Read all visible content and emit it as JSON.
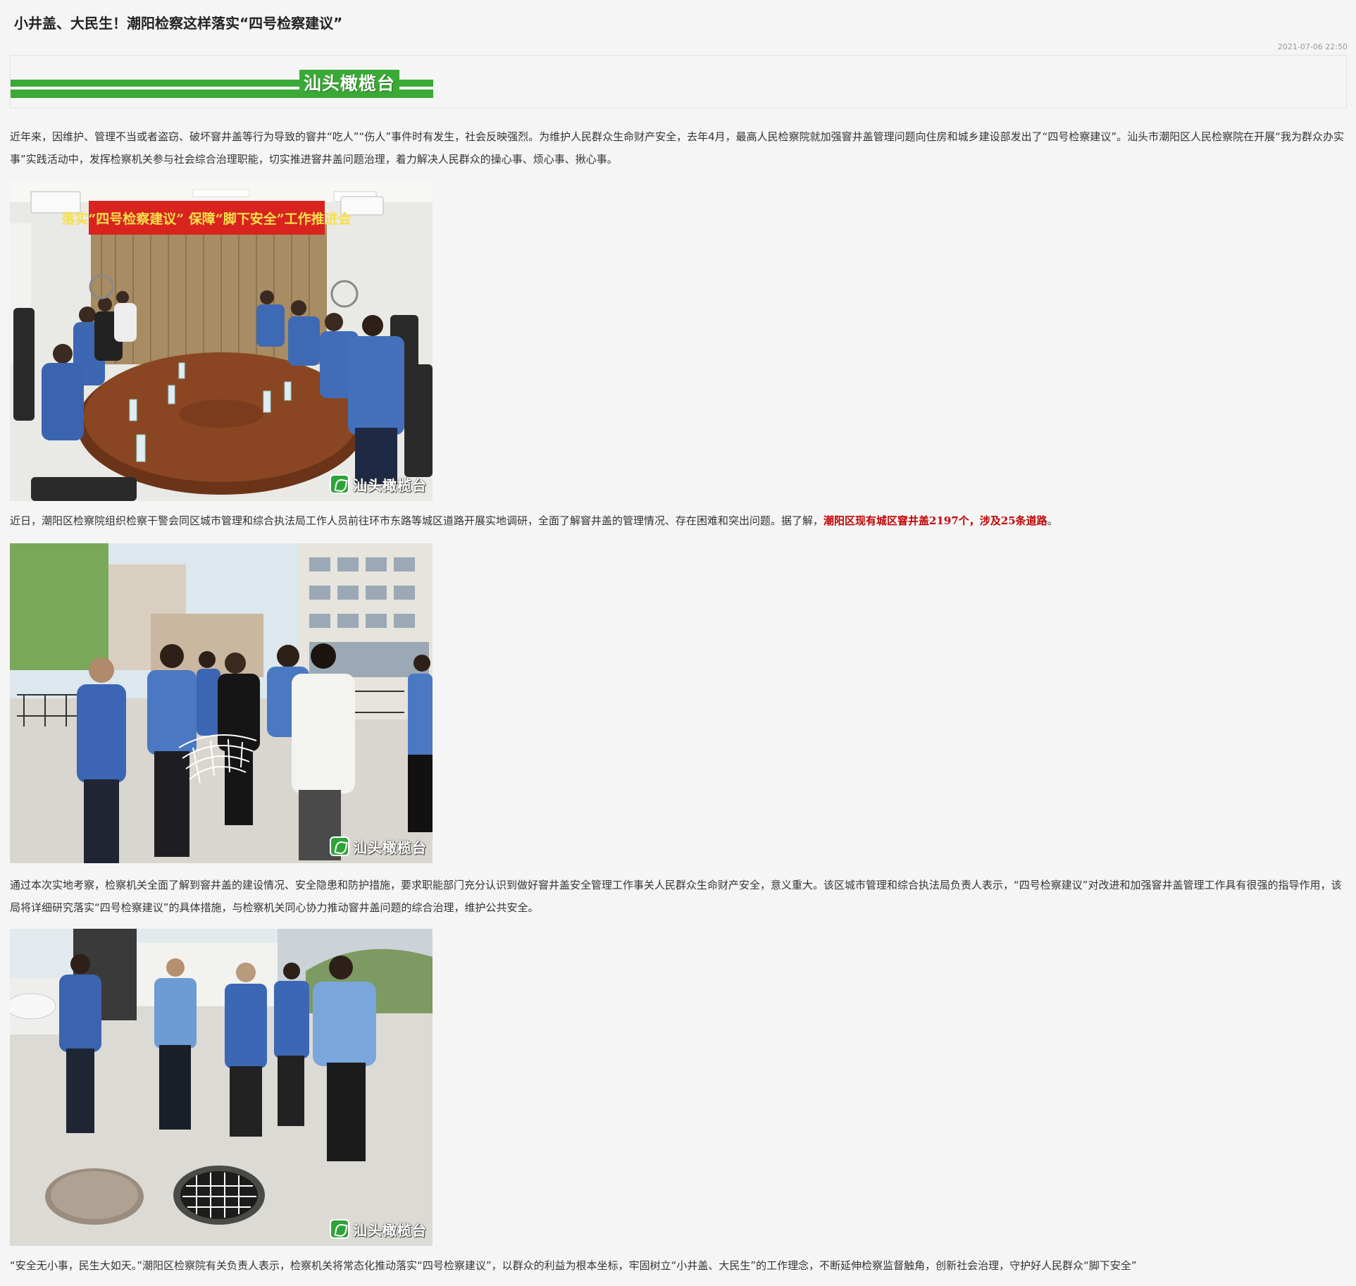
{
  "article": {
    "title": "小井盖、大民生！潮阳检察这样落实“四号检察建议”",
    "timestamp": "2021-07-06 22:50",
    "banner_text": "汕头橄榄台"
  },
  "paragraphs": {
    "p1": "近年来，因维护、管理不当或者盗窃、破坏窨井盖等行为导致的窨井“吃人”“伤人”事件时有发生，社会反映强烈。为维护人民群众生命财产安全，去年4月，最高人民检察院就加强窨井盖管理问题向住房和城乡建设部发出了“四号检察建议”。汕头市潮阳区人民检察院在开展“我为群众办实事”实践活动中，发挥检察机关参与社会综合治理职能，切实推进窨井盖问题治理，着力解决人民群众的操心事、烦心事、揪心事。",
    "p2_main": "近日，潮阳区检察院组织检察干警会同区城市管理和综合执法局工作人员前往环市东路等城区道路开展实地调研，全面了解窨井盖的管理情况、存在困难和突出问题。据了解，",
    "p2_highlight": "潮阳区现有城区窨井盖2197个，涉及25条道路",
    "p2_end": "。",
    "p3": "通过本次实地考察，检察机关全面了解到窨井盖的建设情况、安全隐患和防护措施，要求职能部门充分认识到做好窨井盖安全管理工作事关人民群众生命财产安全，意义重大。该区城市管理和综合执法局负责人表示，“四号检察建议”对改进和加强窨井盖管理工作具有很强的指导作用，该局将详细研究落实“四号检察建议”的具体措施，与检察机关同心协力推动窨井盖问题的综合治理，维护公共安全。",
    "p4": "“安全无小事，民生大如天。”潮阳区检察院有关负责人表示，检察机关将常态化推动落实“四号检察建议”，以群众的利益为根本坐标，牢固树立“小井盖、大民生”的工作理念，不断延伸检察监督触角，创新社会治理，守护好人民群众“脚下安全”"
  },
  "photos": {
    "photo1": {
      "banner_text": "落实“四号检察建议”  保障“脚下安全”工作推进会",
      "watermark": "汕头橄榄台"
    },
    "photo2": {
      "watermark": "汕头橄榄台"
    },
    "photo3": {
      "watermark": "汕头橄榄台"
    }
  },
  "colors": {
    "brand_green": "#3aa935",
    "highlight_red": "#c00000",
    "page_bg": "#f5f5f5"
  }
}
